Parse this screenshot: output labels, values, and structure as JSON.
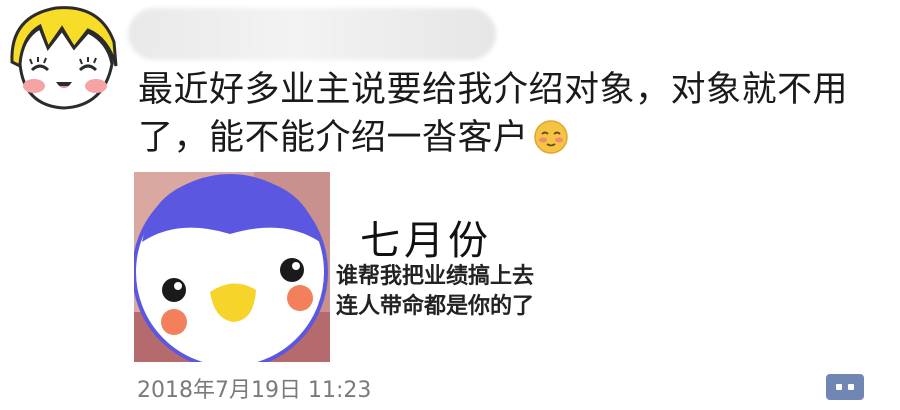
{
  "post": {
    "text": "最近好多业主说要给我介绍对象，对象就不用了，能不能介绍一沓客户",
    "emoji": "blush-face-emoji"
  },
  "card": {
    "title": "七月份",
    "line1": "谁帮我把业绩搞上去",
    "line2": "连人带命都是你的了"
  },
  "timestamp": "2018年7月19日 11:23",
  "icons": {
    "author_avatar": "cartoon-girl-avatar",
    "card_image": "penguin-face-image",
    "comment": "comment-icon"
  },
  "colors": {
    "text": "#1a1a1a",
    "timestamp": "#7a7a7a",
    "comment_button": "#6f87b2",
    "penguin_blue": "#5b57e0"
  }
}
